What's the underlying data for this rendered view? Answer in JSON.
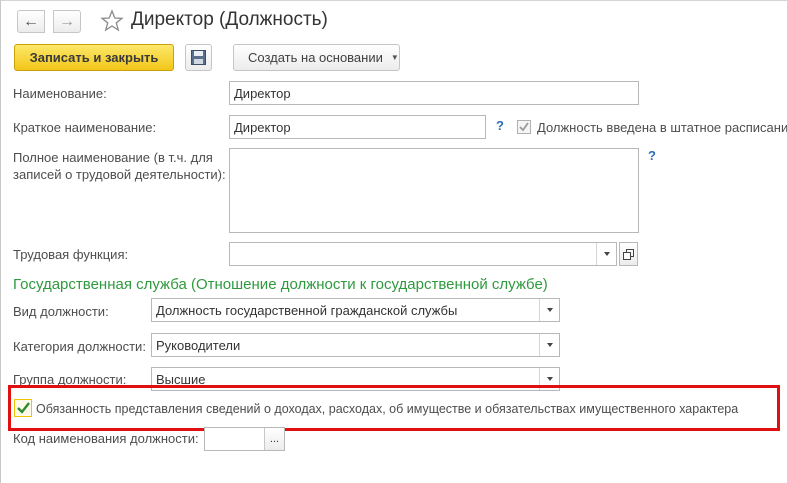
{
  "window": {
    "title": "Директор (Должность)",
    "back_icon": "←",
    "forward_icon": "→"
  },
  "toolbar": {
    "save_close_label": "Записать и закрыть",
    "create_based_label": "Создать на основании"
  },
  "form": {
    "name_label": "Наименование:",
    "name_value": "Директор",
    "short_name_label": "Краткое наименование:",
    "short_name_value": "Директор",
    "help_mark": "?",
    "staffing_label": "Должность введена в штатное расписани",
    "staffing_checked": true,
    "full_name_label_line1": "Полное наименование (в т.ч. для",
    "full_name_label_line2": "записей о трудовой деятельности):",
    "full_name_value": "",
    "labor_function_label": "Трудовая функция:",
    "labor_function_value": ""
  },
  "civil_service": {
    "section_title": "Государственная служба (Отношение должности к государственной службе)",
    "position_type_label": "Вид должности:",
    "position_type_value": "Должность государственной гражданской службы",
    "category_label": "Категория должности:",
    "category_value": "Руководители",
    "group_label": "Группа должности:",
    "group_value": "Высшие",
    "income_duty_label": "Обязанность представления сведений о доходах, расходах, об имуществе и обязательствах имущественного характера",
    "income_duty_checked": true,
    "position_code_label": "Код наименования должности:",
    "position_code_value": "",
    "ellipsis": "..."
  },
  "colors": {
    "accent_yellow": "#f2c619",
    "section_green": "#2e9a3e",
    "highlight_red": "#e01010",
    "help_blue": "#2a6fb8"
  }
}
